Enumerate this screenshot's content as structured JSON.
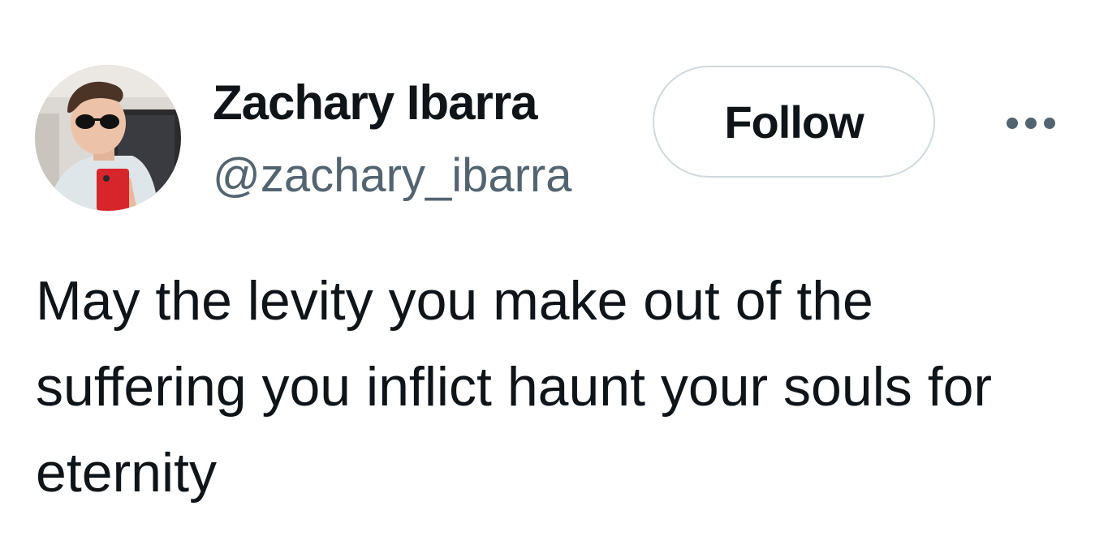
{
  "author": {
    "display_name": "Zachary Ibarra",
    "handle": "@zachary_ibarra",
    "avatar_icon": "profile-photo"
  },
  "actions": {
    "follow_label": "Follow",
    "more_icon": "more-horizontal-icon"
  },
  "tweet": {
    "text": "May the levity you make out of the suffering you inflict haunt your souls for eternity"
  },
  "colors": {
    "text_primary": "#0f1419",
    "text_secondary": "#536471",
    "button_border": "#cfd9de"
  }
}
